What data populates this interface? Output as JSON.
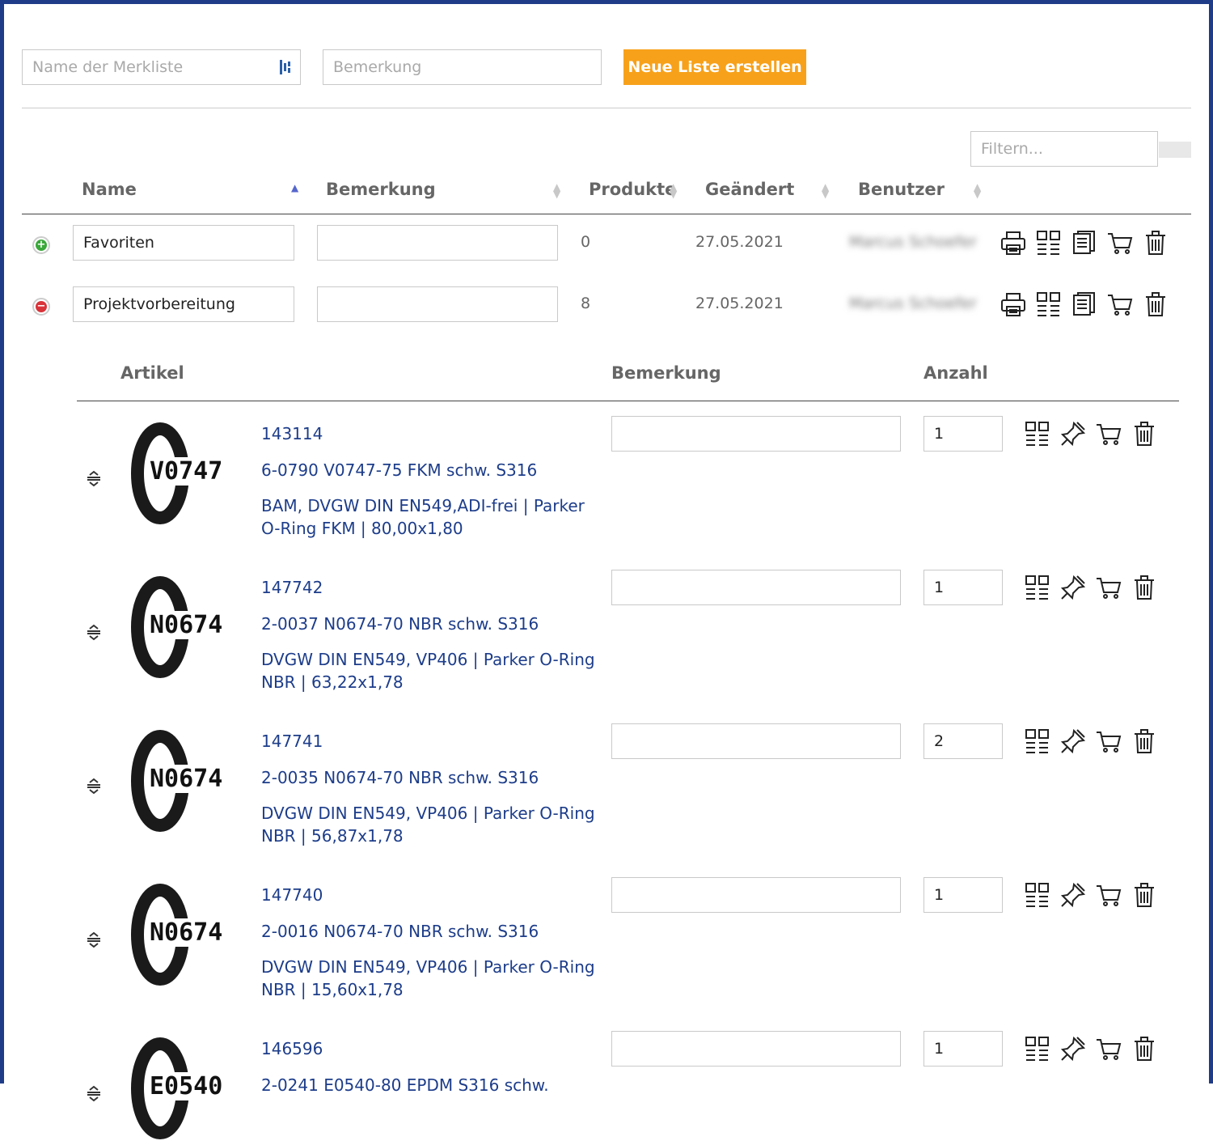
{
  "create_form": {
    "name_placeholder": "Name der Merkliste",
    "remark_placeholder": "Bemerkung",
    "create_button": "Neue Liste erstellen"
  },
  "filter_placeholder": "Filtern...",
  "list_table": {
    "headers": {
      "name": "Name",
      "remark": "Bemerkung",
      "products": "Produkte",
      "changed": "Geändert",
      "user": "Benutzer"
    },
    "rows": [
      {
        "name": "Favoriten",
        "remark": "",
        "products": "0",
        "changed": "27.05.2021",
        "user": "Marcus Schoefer",
        "expand": "+"
      },
      {
        "name": "Projektvorbereitung",
        "remark": "",
        "products": "8",
        "changed": "27.05.2021",
        "user": "Marcus Schoefer",
        "expand": "−"
      }
    ]
  },
  "article_table": {
    "headers": {
      "article": "Artikel",
      "remark": "Bemerkung",
      "quantity": "Anzahl"
    },
    "items": [
      {
        "number": "143114",
        "title": "6-0790 V0747-75 FKM schw. S316",
        "desc1": "BAM, DVGW DIN EN549,ADI-frei | Parker",
        "desc2": "O-Ring FKM | 80,00x1,80",
        "image_label": "V0747",
        "remark": "",
        "qty": "1"
      },
      {
        "number": "147742",
        "title": "2-0037 N0674-70 NBR schw. S316",
        "desc1": "DVGW DIN EN549, VP406 | Parker O-Ring",
        "desc2": "NBR | 63,22x1,78",
        "image_label": "N0674",
        "remark": "",
        "qty": "1"
      },
      {
        "number": "147741",
        "title": "2-0035 N0674-70 NBR schw. S316",
        "desc1": "DVGW DIN EN549, VP406 | Parker O-Ring",
        "desc2": "NBR | 56,87x1,78",
        "image_label": "N0674",
        "remark": "",
        "qty": "2"
      },
      {
        "number": "147740",
        "title": "2-0016 N0674-70 NBR schw. S316",
        "desc1": "DVGW DIN EN549, VP406 | Parker O-Ring",
        "desc2": "NBR | 15,60x1,78",
        "image_label": "N0674",
        "remark": "",
        "qty": "1"
      },
      {
        "number": "146596",
        "title": "2-0241 E0540-80 EPDM S316 schw.",
        "desc1": "",
        "desc2": "",
        "image_label": "E0540",
        "remark": "",
        "qty": "1"
      }
    ]
  },
  "icons": {
    "list_actions": [
      "printer-icon",
      "qr-list-icon",
      "document-copy-icon",
      "cart-icon",
      "trash-icon"
    ],
    "item_actions": [
      "qr-list-icon",
      "pin-icon",
      "cart-icon",
      "trash-icon"
    ],
    "colors": {
      "accent": "#f7a11a",
      "link": "#1d3d8a",
      "frame": "#1f3c88",
      "add": "#3aa83a",
      "remove": "#d9333a"
    }
  }
}
